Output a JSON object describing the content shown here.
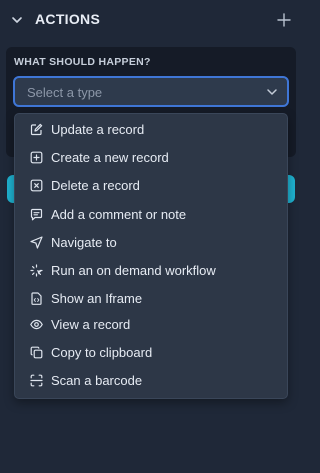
{
  "header": {
    "title": "ACTIONS",
    "collapse_icon": "chevron-down-icon",
    "add_icon": "plus-icon"
  },
  "panel": {
    "label": "WHAT SHOULD HAPPEN?",
    "select": {
      "placeholder": "Select a type",
      "value": ""
    }
  },
  "menu": {
    "items": [
      {
        "label": "Update a record",
        "icon": "edit-icon"
      },
      {
        "label": "Create a new record",
        "icon": "plus-square-icon"
      },
      {
        "label": "Delete a record",
        "icon": "x-square-icon"
      },
      {
        "label": "Add a comment or note",
        "icon": "comment-icon"
      },
      {
        "label": "Navigate to",
        "icon": "navigation-arrow-icon"
      },
      {
        "label": "Run an on demand workflow",
        "icon": "workflow-icon"
      },
      {
        "label": "Show an Iframe",
        "icon": "document-code-icon"
      },
      {
        "label": "View a record",
        "icon": "eye-icon"
      },
      {
        "label": "Copy to clipboard",
        "icon": "copy-icon"
      },
      {
        "label": "Scan a barcode",
        "icon": "scan-icon"
      }
    ]
  },
  "colors": {
    "background": "#1f2838",
    "panel": "#151b27",
    "select_border": "#3f76d6",
    "dropdown_bg": "#2d3747",
    "accent_teal": "#1fb1cf"
  }
}
